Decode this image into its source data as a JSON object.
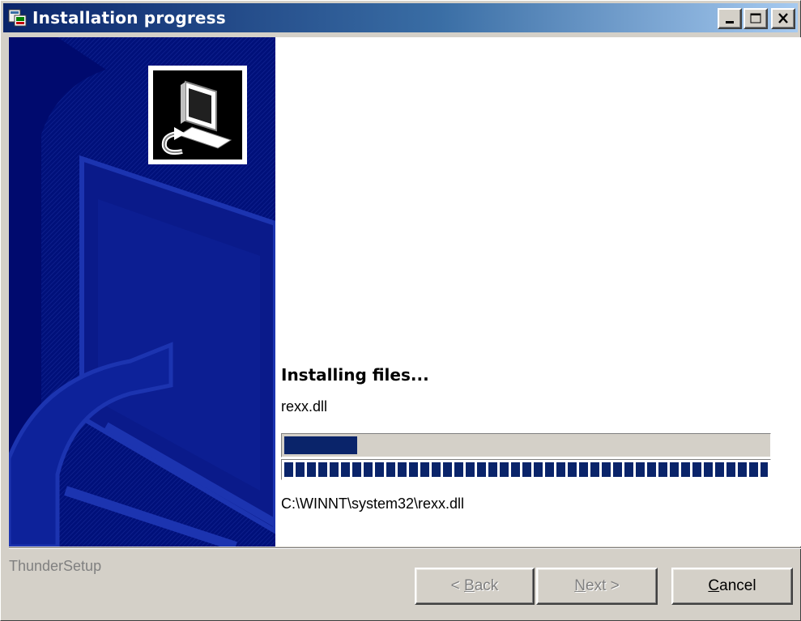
{
  "window": {
    "title": "Installation progress"
  },
  "progress": {
    "heading": "Installing files...",
    "current_file": "rexx.dll",
    "file_progress": 0.15,
    "total_progress": 1.0,
    "target_path": "C:\\WINNT\\system32\\rexx.dll"
  },
  "footer": {
    "brand": "ThunderSetup",
    "back": {
      "label": "< Back",
      "accel": "B"
    },
    "next": {
      "label": "Next >",
      "accel": "N"
    },
    "cancel": {
      "label": "Cancel",
      "accel": "C"
    }
  },
  "icons": {
    "app": "installer-icon",
    "minimize": "minimize-icon",
    "maximize": "maximize-icon",
    "close": "close-icon",
    "logo": "computer-install-icon"
  },
  "colors": {
    "title_start": "#0a246a",
    "title_end": "#a6caf0",
    "banner": "#000a6e",
    "progress": "#0a246a",
    "face": "#d4d0c8"
  }
}
